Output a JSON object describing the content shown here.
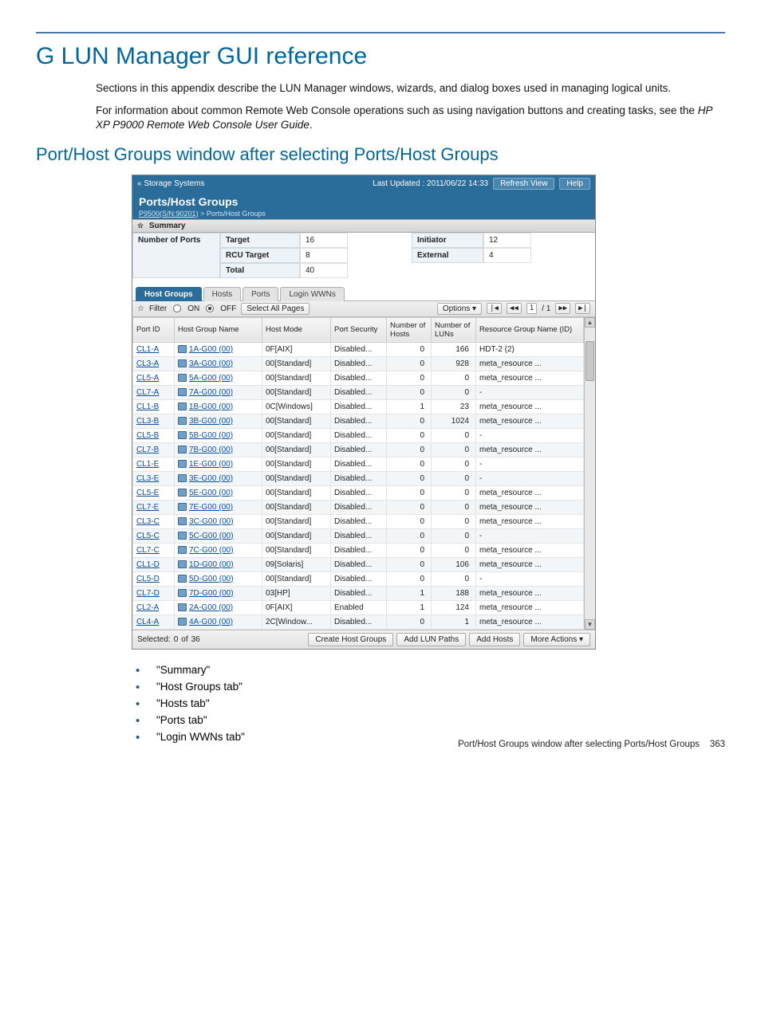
{
  "page": {
    "title": "G LUN Manager GUI reference",
    "para1": "Sections in this appendix describe the LUN Manager windows, wizards, and dialog boxes used in managing logical units.",
    "para2a": "For information about common Remote Web Console operations such as using navigation buttons and creating tasks, see the ",
    "para2b": "HP XP P9000 Remote Web Console User Guide",
    "para2c": ".",
    "subheading": "Port/Host Groups window after selecting Ports/Host Groups",
    "footer": "Port/Host Groups window after selecting Ports/Host Groups",
    "footer_page": "363"
  },
  "screenshot": {
    "topbar": {
      "storage_systems": "« Storage Systems",
      "last_updated": "Last Updated : 2011/06/22 14:33",
      "refresh": "Refresh View",
      "help": "Help"
    },
    "header": {
      "title": "Ports/Host Groups",
      "bc_link": "P9500(S/N:90201)",
      "bc_sep": " > ",
      "bc_here": "Ports/Host Groups"
    },
    "summary": {
      "heading": "Summary",
      "rowlabel": "Number of Ports",
      "rows": [
        {
          "l1": "Target",
          "v1": "16",
          "l2": "Initiator",
          "v2": "12"
        },
        {
          "l1": "RCU Target",
          "v1": "8",
          "l2": "External",
          "v2": "4"
        },
        {
          "l1": "Total",
          "v1": "40",
          "l2": "",
          "v2": ""
        }
      ]
    },
    "tabs": {
      "t0": "Host Groups",
      "t1": "Hosts",
      "t2": "Ports",
      "t3": "Login WWNs"
    },
    "filter": {
      "filter_label": "Filter",
      "on": "ON",
      "off": "OFF",
      "select_all": "Select All Pages",
      "options": "Options ▾",
      "nav_first": "|◀",
      "nav_prev": "◀◀",
      "page": "1",
      "page_of": "/ 1",
      "nav_next": "▶▶",
      "nav_last": "▶|",
      "caret": "☆"
    },
    "columns": {
      "c0": "Port ID",
      "c1": "Host Group Name",
      "c2": "Host Mode",
      "c3": "Port Security",
      "c4": "Number of Hosts",
      "c5": "Number of LUNs",
      "c6": "Resource Group Name (ID)"
    },
    "rows": [
      {
        "port": "CL1-A",
        "hg": "1A-G00 (00)",
        "mode": "0F[AIX]",
        "sec": "Disabled...",
        "hosts": "0",
        "luns": "166",
        "rg": "HDT-2 (2)"
      },
      {
        "port": "CL3-A",
        "hg": "3A-G00 (00)",
        "mode": "00[Standard]",
        "sec": "Disabled...",
        "hosts": "0",
        "luns": "928",
        "rg": "meta_resource ..."
      },
      {
        "port": "CL5-A",
        "hg": "5A-G00 (00)",
        "mode": "00[Standard]",
        "sec": "Disabled...",
        "hosts": "0",
        "luns": "0",
        "rg": "meta_resource ..."
      },
      {
        "port": "CL7-A",
        "hg": "7A-G00 (00)",
        "mode": "00[Standard]",
        "sec": "Disabled...",
        "hosts": "0",
        "luns": "0",
        "rg": "-"
      },
      {
        "port": "CL1-B",
        "hg": "1B-G00 (00)",
        "mode": "0C[Windows]",
        "sec": "Disabled...",
        "hosts": "1",
        "luns": "23",
        "rg": "meta_resource ..."
      },
      {
        "port": "CL3-B",
        "hg": "3B-G00 (00)",
        "mode": "00[Standard]",
        "sec": "Disabled...",
        "hosts": "0",
        "luns": "1024",
        "rg": "meta_resource ..."
      },
      {
        "port": "CL5-B",
        "hg": "5B-G00 (00)",
        "mode": "00[Standard]",
        "sec": "Disabled...",
        "hosts": "0",
        "luns": "0",
        "rg": "-"
      },
      {
        "port": "CL7-B",
        "hg": "7B-G00 (00)",
        "mode": "00[Standard]",
        "sec": "Disabled...",
        "hosts": "0",
        "luns": "0",
        "rg": "meta_resource ..."
      },
      {
        "port": "CL1-E",
        "hg": "1E-G00 (00)",
        "mode": "00[Standard]",
        "sec": "Disabled...",
        "hosts": "0",
        "luns": "0",
        "rg": "-"
      },
      {
        "port": "CL3-E",
        "hg": "3E-G00 (00)",
        "mode": "00[Standard]",
        "sec": "Disabled...",
        "hosts": "0",
        "luns": "0",
        "rg": "-"
      },
      {
        "port": "CL5-E",
        "hg": "5E-G00 (00)",
        "mode": "00[Standard]",
        "sec": "Disabled...",
        "hosts": "0",
        "luns": "0",
        "rg": "meta_resource ..."
      },
      {
        "port": "CL7-E",
        "hg": "7E-G00 (00)",
        "mode": "00[Standard]",
        "sec": "Disabled...",
        "hosts": "0",
        "luns": "0",
        "rg": "meta_resource ..."
      },
      {
        "port": "CL3-C",
        "hg": "3C-G00 (00)",
        "mode": "00[Standard]",
        "sec": "Disabled...",
        "hosts": "0",
        "luns": "0",
        "rg": "meta_resource ..."
      },
      {
        "port": "CL5-C",
        "hg": "5C-G00 (00)",
        "mode": "00[Standard]",
        "sec": "Disabled...",
        "hosts": "0",
        "luns": "0",
        "rg": "-"
      },
      {
        "port": "CL7-C",
        "hg": "7C-G00 (00)",
        "mode": "00[Standard]",
        "sec": "Disabled...",
        "hosts": "0",
        "luns": "0",
        "rg": "meta_resource ..."
      },
      {
        "port": "CL1-D",
        "hg": "1D-G00 (00)",
        "mode": "09[Solaris]",
        "sec": "Disabled...",
        "hosts": "0",
        "luns": "106",
        "rg": "meta_resource ..."
      },
      {
        "port": "CL5-D",
        "hg": "5D-G00 (00)",
        "mode": "00[Standard]",
        "sec": "Disabled...",
        "hosts": "0",
        "luns": "0",
        "rg": "-"
      },
      {
        "port": "CL7-D",
        "hg": "7D-G00 (00)",
        "mode": "03[HP]",
        "sec": "Disabled...",
        "hosts": "1",
        "luns": "188",
        "rg": "meta_resource ..."
      },
      {
        "port": "CL2-A",
        "hg": "2A-G00 (00)",
        "mode": "0F[AIX]",
        "sec": "Enabled",
        "hosts": "1",
        "luns": "124",
        "rg": "meta_resource ..."
      },
      {
        "port": "CL4-A",
        "hg": "4A-G00 (00)",
        "mode": "2C[Window...",
        "sec": "Disabled...",
        "hosts": "0",
        "luns": "1",
        "rg": "meta_resource ..."
      }
    ],
    "footer": {
      "selected_label": "Selected:",
      "selected": "0",
      "of": "of",
      "total": "36",
      "b1": "Create Host Groups",
      "b2": "Add LUN Paths",
      "b3": "Add Hosts",
      "b4": "More Actions ▾"
    }
  },
  "list": {
    "i0": "\"Summary\"",
    "i1": "\"Host Groups tab\"",
    "i2": "\"Hosts tab\"",
    "i3": "\"Ports tab\"",
    "i4": "\"Login WWNs tab\""
  }
}
